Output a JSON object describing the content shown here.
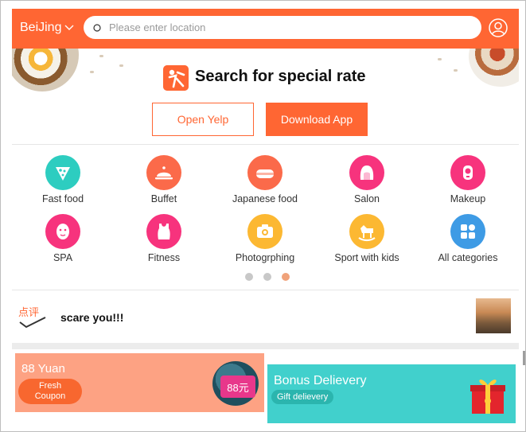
{
  "header": {
    "city": "BeiJing",
    "search_placeholder": "Please enter location"
  },
  "hero": {
    "title": "Search for special rate",
    "open_button": "Open Yelp",
    "download_button": "Download App"
  },
  "categories": [
    {
      "label": "Fast food",
      "icon": "pizza-icon",
      "color": "#2dcdc0"
    },
    {
      "label": "Buffet",
      "icon": "cloche-icon",
      "color": "#fb6a4a"
    },
    {
      "label": "Japanese food",
      "icon": "sushi-icon",
      "color": "#fb6a4a"
    },
    {
      "label": "Salon",
      "icon": "hair-icon",
      "color": "#f7337d"
    },
    {
      "label": "Makeup",
      "icon": "makeup-icon",
      "color": "#f7337d"
    },
    {
      "label": "SPA",
      "icon": "face-mask-icon",
      "color": "#f7337d"
    },
    {
      "label": "Fitness",
      "icon": "tank-top-icon",
      "color": "#f7337d"
    },
    {
      "label": "Photogrphing",
      "icon": "camera-icon",
      "color": "#fcb832"
    },
    {
      "label": "Sport with kids",
      "icon": "rocking-horse-icon",
      "color": "#fcb832"
    },
    {
      "label": "All categories",
      "icon": "grid-icon",
      "color": "#3e9be5"
    }
  ],
  "carousel": {
    "count": 3,
    "active": 3
  },
  "news": {
    "logo_text": "点评",
    "text": "scare you!!!"
  },
  "promos": [
    {
      "title": "88 Yuan",
      "tag": "Fresh Coupon",
      "badge": "88元",
      "color": "#fda283"
    },
    {
      "title": "Bonus Delievery",
      "tag": "Gift delievery",
      "color": "#41d0cc"
    }
  ],
  "colors": {
    "accent": "#ff6633"
  }
}
